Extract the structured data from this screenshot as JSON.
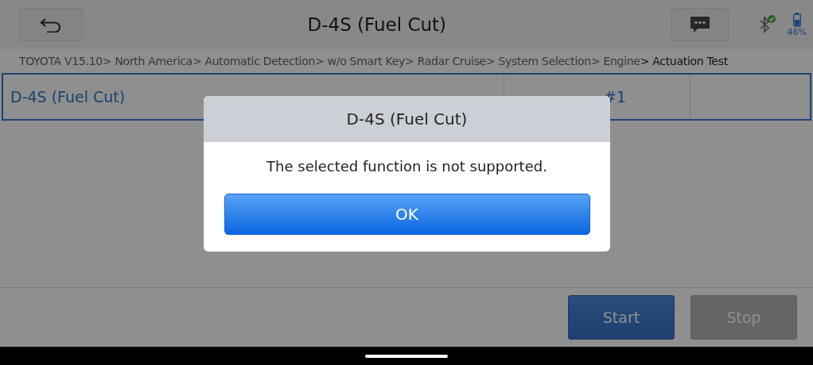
{
  "header": {
    "title": "D-4S (Fuel Cut)",
    "battery": "46%"
  },
  "breadcrumb": [
    {
      "label": "TOYOTA V15.10> North America> Automatic Detection> w/o Smart Key> Radar Cruise> System Selection> Engine",
      "current": false
    },
    {
      "label": "> Actuation Test",
      "current": true
    }
  ],
  "table": {
    "rows": [
      {
        "name": "D-4S (Fuel Cut)",
        "port": "#1"
      }
    ]
  },
  "buttons": [
    {
      "label": "Start",
      "disabled": false
    },
    {
      "label": "Stop",
      "disabled": true
    }
  ],
  "dialog": {
    "title": "D-4S (Fuel Cut)",
    "message": "The selected function is not supported.",
    "button": "OK"
  }
}
